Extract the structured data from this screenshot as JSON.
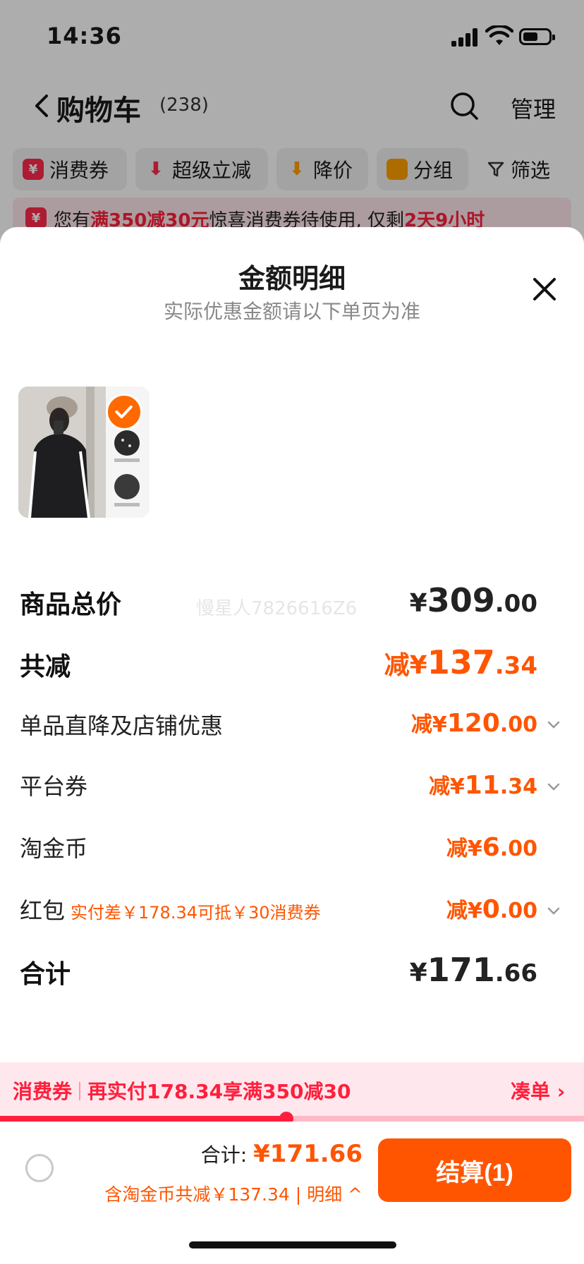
{
  "status_bar": {
    "time": "14:36"
  },
  "cart": {
    "title": "购物车",
    "count": "(238)",
    "manage": "管理",
    "filters": [
      {
        "label": "消费券",
        "icon": "coupon-icon",
        "color": "#ff2a4a"
      },
      {
        "label": "超级立减",
        "icon": "down-arrow-icon",
        "color": "#ff2a4a"
      },
      {
        "label": "降价",
        "icon": "price-drop-icon",
        "color": "#ffa000"
      },
      {
        "label": "分组",
        "icon": "folder-icon",
        "color": "#ffa000"
      },
      {
        "label": "筛选",
        "icon": "filter-icon",
        "color": "#333333"
      }
    ],
    "promo": {
      "p1": "您有",
      "highlight1": "满350减30元",
      "p2": "惊喜消费券待使用, 仅剩",
      "highlight2": "2天9小时"
    }
  },
  "sheet": {
    "title": "金额明细",
    "subtitle": "实际优惠金额请以下单页为准",
    "watermark": "慢星人7826616Z6",
    "rows": [
      {
        "label": "商品总价",
        "prefix": "",
        "symbol": "¥",
        "int": "309",
        "dec": ".00"
      },
      {
        "label": "共减",
        "prefix": "减",
        "symbol": "¥",
        "int": "137",
        "dec": ".34"
      },
      {
        "label": "单品直降及店铺优惠",
        "prefix": "减",
        "symbol": "¥",
        "int": "120",
        "dec": ".00"
      },
      {
        "label": "平台券",
        "prefix": "减",
        "symbol": "¥",
        "int": "11",
        "dec": ".34"
      },
      {
        "label": "淘金币",
        "prefix": "减",
        "symbol": "¥",
        "int": "6",
        "dec": ".00"
      },
      {
        "label": "红包",
        "note": "实付差￥178.34可抵￥30消费券",
        "prefix": "减",
        "symbol": "¥",
        "int": "0",
        "dec": ".00"
      },
      {
        "label": "合计",
        "prefix": "",
        "symbol": "¥",
        "int": "171",
        "dec": ".66"
      }
    ]
  },
  "bottom": {
    "promo_tag": "消费券",
    "promo_msg": "再实付178.34享满350减30",
    "promo_link": "凑单 ›",
    "progress_fraction": 0.49,
    "total_label": "合计: ",
    "total_amount": "¥171.66",
    "savings": "含淘金币共减￥137.34 | 明细 ^",
    "pay_label": "结算(1)"
  },
  "colors": {
    "accent": "#ff5500",
    "promo_red": "#ff1f3d"
  }
}
